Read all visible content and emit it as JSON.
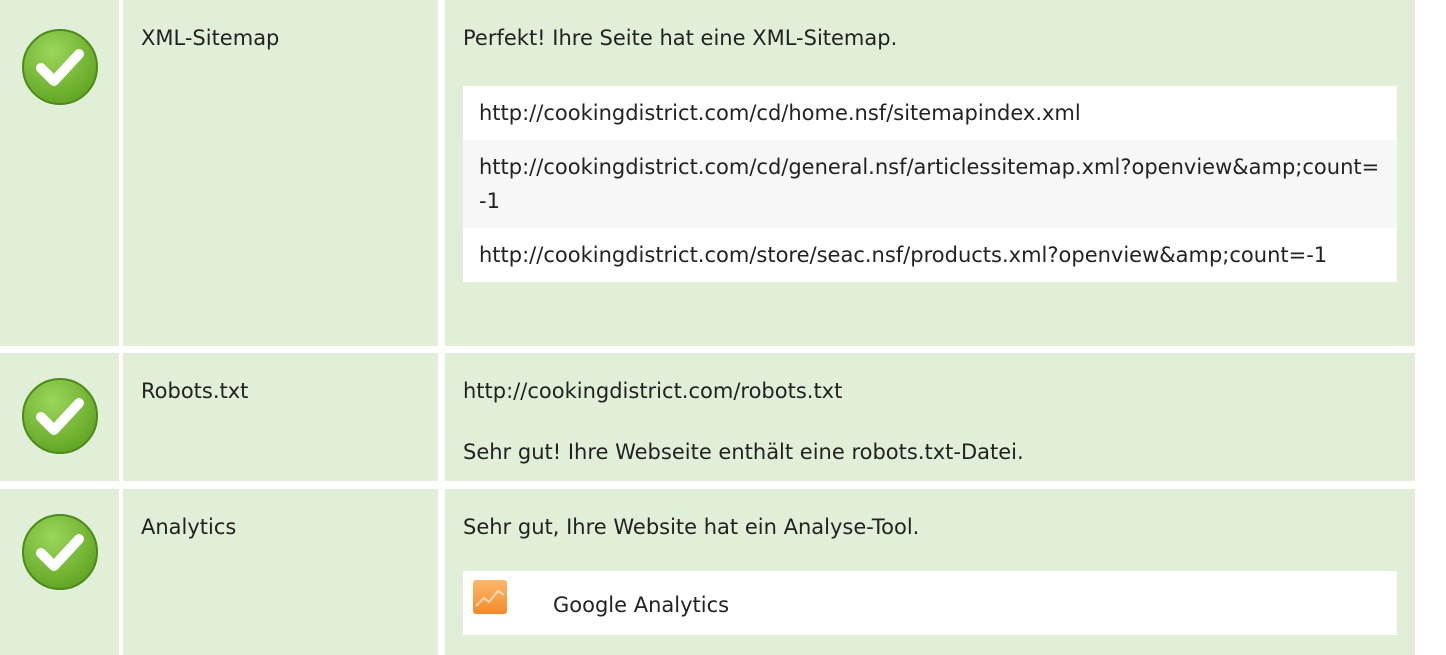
{
  "rows": [
    {
      "status": "passed",
      "label": "XML-Sitemap",
      "message": "Perfekt! Ihre Seite hat eine XML-Sitemap.",
      "urls": [
        "http://cookingdistrict.com/cd/home.nsf/sitemapindex.xml",
        "http://cookingdistrict.com/cd/general.nsf/articlessitemap.xml?openview&amp;count=-1",
        "http://cookingdistrict.com/store/seac.nsf/products.xml?openview&amp;count=-1"
      ]
    },
    {
      "status": "passed",
      "label": "Robots.txt",
      "url": "http://cookingdistrict.com/robots.txt",
      "message": "Sehr gut! Ihre Webseite enthält eine robots.txt-Datei."
    },
    {
      "status": "passed",
      "label": "Analytics",
      "message": "Sehr gut, Ihre Website hat ein Analyse-Tool.",
      "tools": [
        {
          "name": "Google Analytics",
          "icon": "google-analytics-icon"
        }
      ]
    }
  ],
  "colors": {
    "cell_background": "#e1efd9",
    "check_green": "#7cc03a",
    "analytics_orange": "#f7a34a"
  }
}
